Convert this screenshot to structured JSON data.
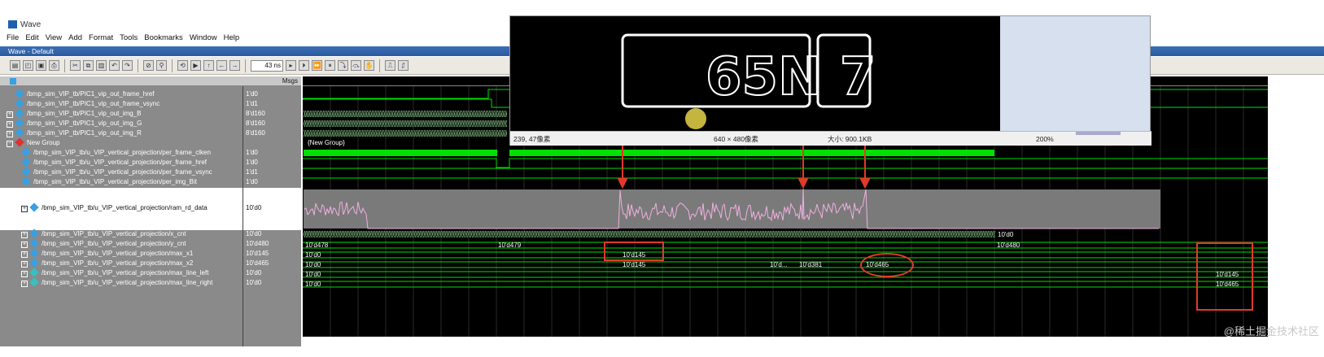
{
  "window": {
    "title": "Wave",
    "subtitle": "Wave - Default"
  },
  "menu": [
    "File",
    "Edit",
    "View",
    "Add",
    "Format",
    "Tools",
    "Bookmarks",
    "Window",
    "Help"
  ],
  "toolbar": {
    "time_value": "43 ns"
  },
  "columns": {
    "msgs": "Msgs"
  },
  "signals": [
    {
      "name": "/bmp_sim_VIP_tb/PIC1_vip_out_frame_href",
      "value": "1'd0",
      "icon": "signal-icon",
      "expand": false
    },
    {
      "name": "/bmp_sim_VIP_tb/PIC1_vip_out_frame_vsync",
      "value": "1'd1",
      "icon": "signal-icon",
      "expand": false
    },
    {
      "name": "/bmp_sim_VIP_tb/PIC1_vip_out_img_B",
      "value": "8'd160",
      "icon": "signal-icon",
      "expand": true
    },
    {
      "name": "/bmp_sim_VIP_tb/PIC1_vip_out_img_G",
      "value": "8'd160",
      "icon": "signal-icon",
      "expand": true
    },
    {
      "name": "/bmp_sim_VIP_tb/PIC1_vip_out_img_R",
      "value": "8'd160",
      "icon": "signal-icon",
      "expand": true
    },
    {
      "name": "New Group",
      "value": "",
      "icon": "group-icon",
      "expand": true
    },
    {
      "name": "/bmp_sim_VIP_tb/u_VIP_vertical_projection/per_frame_clken",
      "value": "1'd0",
      "icon": "signal-icon",
      "expand": false
    },
    {
      "name": "/bmp_sim_VIP_tb/u_VIP_vertical_projection/per_frame_href",
      "value": "1'd0",
      "icon": "signal-icon",
      "expand": false
    },
    {
      "name": "/bmp_sim_VIP_tb/u_VIP_vertical_projection/per_frame_vsync",
      "value": "1'd1",
      "icon": "signal-icon",
      "expand": false
    },
    {
      "name": "/bmp_sim_VIP_tb/u_VIP_vertical_projection/per_img_Bit",
      "value": "1'd0",
      "icon": "signal-icon",
      "expand": false
    },
    {
      "name": "/bmp_sim_VIP_tb/u_VIP_vertical_projection/ram_rd_data",
      "value": "10'd0",
      "icon": "signal-icon",
      "expand": true
    },
    {
      "name": "/bmp_sim_VIP_tb/u_VIP_vertical_projection/x_cnt",
      "value": "10'd0",
      "icon": "signal-icon",
      "expand": true
    },
    {
      "name": "/bmp_sim_VIP_tb/u_VIP_vertical_projection/y_cnt",
      "value": "10'd480",
      "icon": "signal-icon",
      "expand": true
    },
    {
      "name": "/bmp_sim_VIP_tb/u_VIP_vertical_projection/max_x1",
      "value": "10'd145",
      "icon": "signal-icon",
      "expand": true
    },
    {
      "name": "/bmp_sim_VIP_tb/u_VIP_vertical_projection/max_x2",
      "value": "10'd465",
      "icon": "signal-icon",
      "expand": true
    },
    {
      "name": "/bmp_sim_VIP_tb/u_VIP_vertical_projection/max_line_left",
      "value": "10'd0",
      "icon": "signal-icon",
      "expand": true
    },
    {
      "name": "/bmp_sim_VIP_tb/u_VIP_vertical_projection/max_line_right",
      "value": "10'd0",
      "icon": "signal-icon",
      "expand": true
    }
  ],
  "wave_labels": {
    "group": "{New Group}",
    "xcnt_end": "10'd0",
    "ycnt_a": "10'd478",
    "ycnt_b": "10'd479",
    "ycnt_c": "10'd480",
    "x1_a": "10'd0",
    "x1_b": "10'd145",
    "x2_a": "10'd0",
    "x2_b": "10'd145",
    "x2_c": "10'd...",
    "x2_d": "10'd381",
    "x2_e": "10'd465",
    "left_a": "10'd0",
    "left_b": "10'd145",
    "right_a": "10'd0",
    "right_b": "10'd465"
  },
  "viewer": {
    "plate_text": "65N 7",
    "cursor_pos": "239, 47像素",
    "dimensions": "640 × 480像素",
    "file_size": "大小: 900.1KB",
    "zoom": "200%"
  },
  "watermark": "@稀土掘金技术社区",
  "accent": {
    "wave_green": "#00e000",
    "annotation_red": "#e03a2a",
    "analog_fill": "#7a7a7a"
  }
}
